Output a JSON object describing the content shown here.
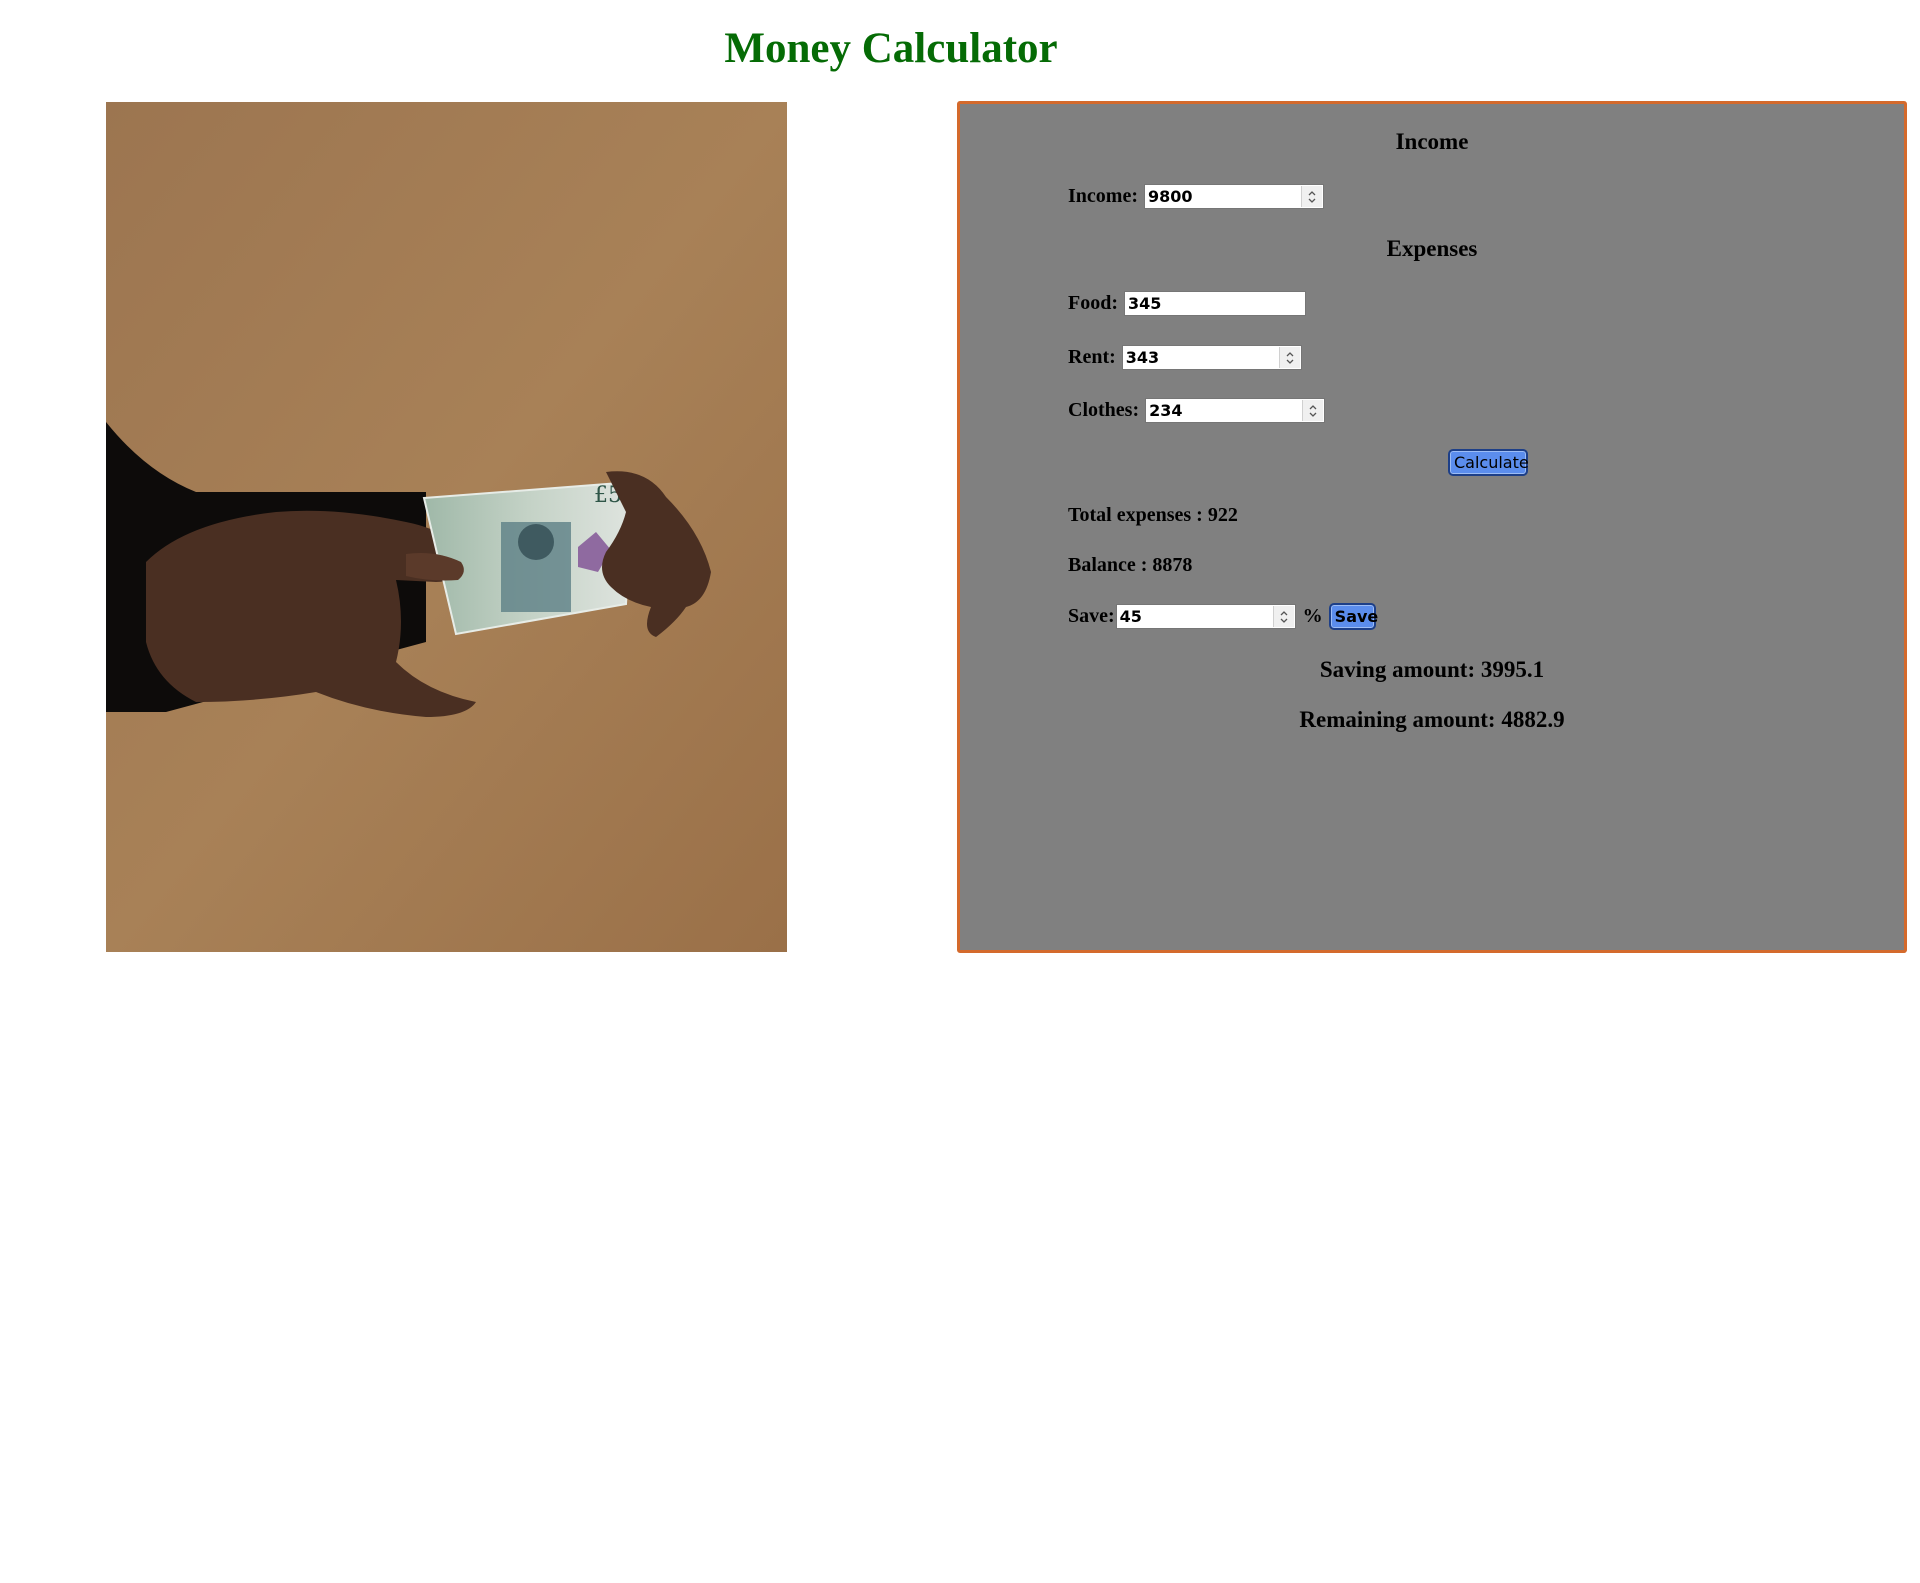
{
  "page": {
    "title": "Money Calculator"
  },
  "photo": {
    "description_icon": "hands-holding-banknote-image"
  },
  "calculator": {
    "income_heading": "Income",
    "income_label": "Income:",
    "income_value": "9800",
    "expenses_heading": "Expenses",
    "food_label": "Food:",
    "food_value": "345",
    "rent_label": "Rent:",
    "rent_value": "343",
    "clothes_label": "Clothes:",
    "clothes_value": "234",
    "calculate_label": "Calculate",
    "total_expenses_text": "Total expenses : 922",
    "balance_text": "Balance : 8878",
    "save_label": "Save:",
    "save_value": "45",
    "percent_sign": "%",
    "save_button_label": "Save",
    "saving_amount_text": "Saving amount: 3995.1",
    "remaining_amount_text": "Remaining amount: 4882.9"
  },
  "colors": {
    "title": "#056b05",
    "panel_background": "#808080",
    "panel_border": "#d46a2c",
    "button": "#5b8ded"
  }
}
